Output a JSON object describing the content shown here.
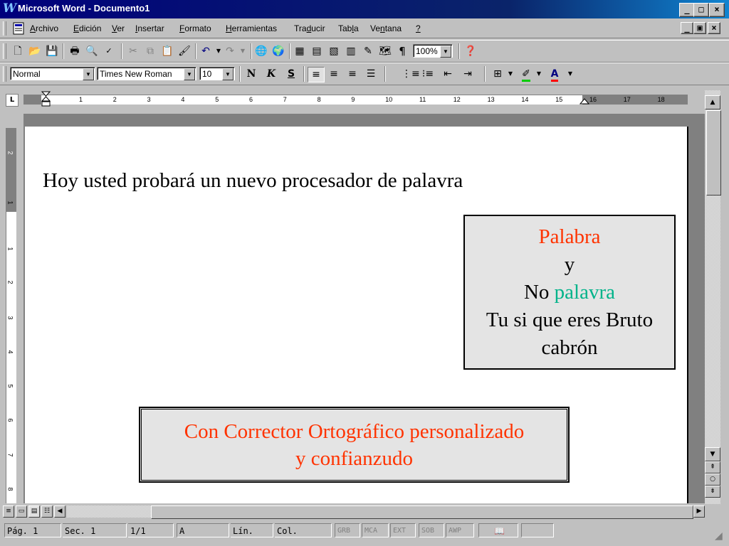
{
  "titlebar": {
    "app_icon": "W",
    "title": "Microsoft Word - Documento1",
    "min": "_",
    "max": "□",
    "close": "×"
  },
  "menubar": {
    "items": [
      {
        "key": "A",
        "rest": "rchivo"
      },
      {
        "key": "E",
        "rest": "dición"
      },
      {
        "key": "V",
        "rest": "er"
      },
      {
        "key": "I",
        "rest": "nsertar"
      },
      {
        "key": "F",
        "rest": "ormato"
      },
      {
        "key": "H",
        "rest": "erramientas"
      },
      {
        "pre": "Tra",
        "key": "d",
        "rest": "ucir"
      },
      {
        "pre": "Tab",
        "key": "l",
        "rest": "a"
      },
      {
        "pre": "Ve",
        "key": "n",
        "rest": "tana"
      },
      {
        "key": "?",
        "rest": ""
      }
    ],
    "doc_min": "_",
    "doc_restore": "ð",
    "doc_close": "×"
  },
  "standard_toolbar": {
    "icons": [
      "new-icon",
      "open-icon",
      "save-icon",
      "print-icon",
      "print-preview-icon",
      "spelling-icon",
      "cut-icon",
      "copy-icon",
      "paste-icon",
      "format-painter-icon",
      "undo-icon",
      "redo-icon",
      "hyperlink-icon",
      "web-toolbar-icon",
      "tables-borders-icon",
      "insert-table-icon",
      "insert-excel-icon",
      "columns-icon",
      "drawing-icon",
      "document-map-icon",
      "show-hide-icon",
      "help-icon"
    ],
    "zoom": "100%",
    "pilcrow": "¶"
  },
  "formatting_toolbar": {
    "style": "Normal",
    "font": "Times New Roman",
    "size": "10",
    "bold": "N",
    "italic": "K",
    "underline": "S",
    "font_color_letter": "A"
  },
  "ruler": {
    "numbers": [
      "1",
      "2",
      "3",
      "4",
      "5",
      "6",
      "7",
      "8",
      "9",
      "10",
      "11",
      "12",
      "13",
      "14",
      "15",
      "16",
      "17",
      "18"
    ],
    "tab_selector": "L"
  },
  "vruler": {
    "numbers": [
      "2",
      "1",
      "1",
      "2",
      "3",
      "4",
      "5",
      "6",
      "7",
      "8"
    ]
  },
  "document": {
    "line1": "Hoy usted probará un nuevo procesador de palavra",
    "box1": {
      "word1": "Palabra",
      "y": "y",
      "no": "No ",
      "word2": "palavra",
      "line4": "Tu si que eres Bruto",
      "line5": "cabrón"
    },
    "box2": {
      "line1": "Con Corrector Ortográfico personalizado",
      "line2": "y confianzudo"
    }
  },
  "colors": {
    "red_text": "#ff3300",
    "teal_text": "#00b38a",
    "title_blue": "#00007c"
  },
  "statusbar": {
    "page": "Pág. 1",
    "section": "Sec. 1",
    "pages": "1/1",
    "at": "A",
    "line": "Lín.",
    "col": "Col.",
    "grb": "GRB",
    "mca": "MCA",
    "ext": "EXT",
    "sob": "SOB",
    "awp": "AWP"
  }
}
